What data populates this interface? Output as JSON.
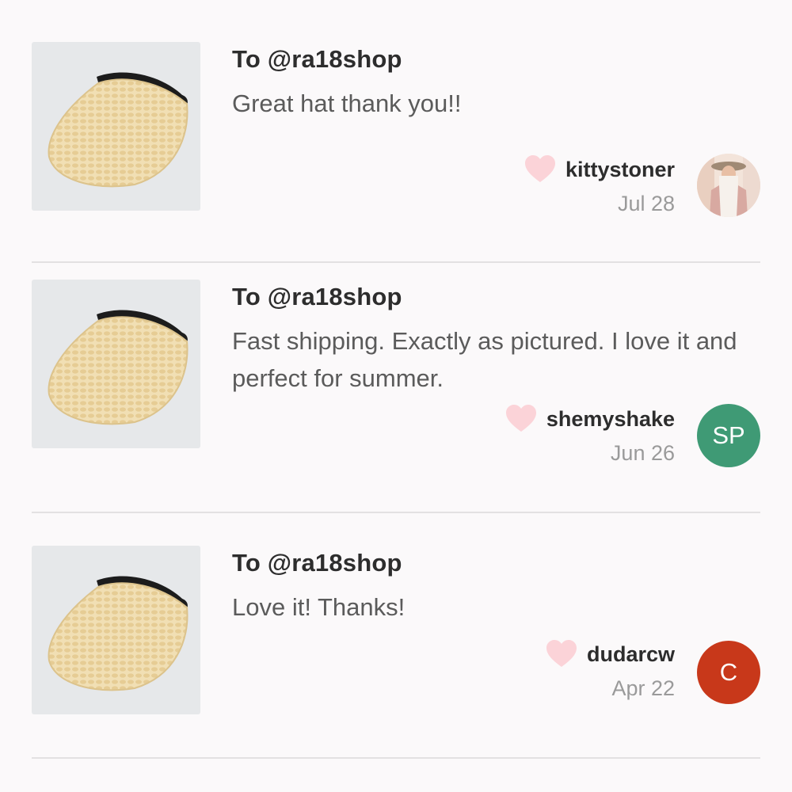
{
  "reviews": [
    {
      "to": "To @ra18shop",
      "message": "Great hat thank you!!",
      "username": "kittystoner",
      "date": "Jul 28",
      "avatar": {
        "type": "photo",
        "initials": ""
      }
    },
    {
      "to": "To @ra18shop",
      "message": "Fast shipping. Exactly as pictured. I love it and perfect for summer.",
      "username": "shemyshake",
      "date": "Jun 26",
      "avatar": {
        "type": "initials",
        "initials": "SP",
        "color": "#3f9a75"
      }
    },
    {
      "to": "To @ra18shop",
      "message": "Love it! Thanks!",
      "username": "dudarcw",
      "date": "Apr 22",
      "avatar": {
        "type": "initials",
        "initials": "C",
        "color": "#c8381a"
      }
    }
  ],
  "icons": {
    "heart": "heart-icon",
    "product": "straw-visor-hat-image"
  },
  "colors": {
    "heart": "#fbd3d8",
    "background": "#fbf9fa"
  }
}
